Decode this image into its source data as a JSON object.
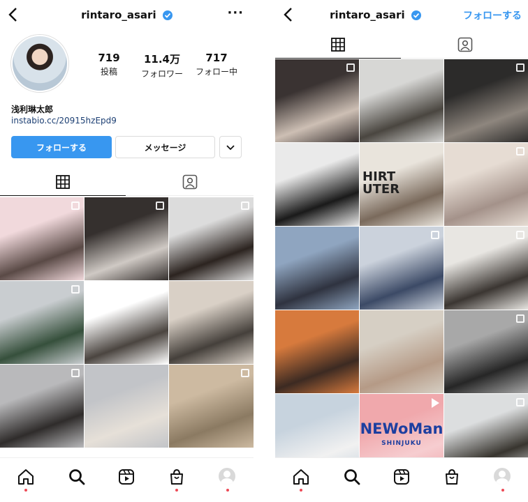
{
  "left": {
    "username": "rintaro_asari",
    "stats": [
      {
        "number": "719",
        "label": "投稿"
      },
      {
        "number": "11.4万",
        "label": "フォロワー"
      },
      {
        "number": "717",
        "label": "フォロー中"
      }
    ],
    "full_name": "浅利琳太郎",
    "bio_link": "instabio.cc/20915hzEpd9",
    "follow_button": "フォローする",
    "message_button": "メッセージ",
    "posts": [
      {
        "c1": "#f1d9dc",
        "c2": "#5a4a46",
        "badge": "multi"
      },
      {
        "c1": "#35302e",
        "c2": "#cfc9c4",
        "badge": "multi"
      },
      {
        "c1": "#dcdcdc",
        "c2": "#2c2420",
        "badge": "multi"
      },
      {
        "c1": "#c9cdd0",
        "c2": "#36503c",
        "badge": "multi"
      },
      {
        "c1": "#ffffff",
        "c2": "#4b4540",
        "badge": "multi"
      },
      {
        "c1": "#d9d0c6",
        "c2": "#45403b",
        "badge": "none"
      },
      {
        "c1": "#b9b9bb",
        "c2": "#2f2c2b",
        "badge": "multi"
      },
      {
        "c1": "#c2c4c8",
        "c2": "#e6e0d8",
        "badge": "none"
      },
      {
        "c1": "#cdbaa1",
        "c2": "#8b7a62",
        "badge": "multi"
      }
    ]
  },
  "right": {
    "username": "rintaro_asari",
    "follow_link": "フォローする",
    "posts": [
      {
        "c1": "#3a3332",
        "c2": "#cdbfb4",
        "badge": "multi"
      },
      {
        "c1": "#d7d7d5",
        "c2": "#4a4640",
        "badge": "none"
      },
      {
        "c1": "#2c2b2a",
        "c2": "#8e867e",
        "badge": "multi"
      },
      {
        "c1": "#eaeaea",
        "c2": "#1a1a1a",
        "badge": "none"
      },
      {
        "c1": "#e9e4dc",
        "c2": "#7a6a5c",
        "badge": "none",
        "text": "HIRT\nUTER"
      },
      {
        "c1": "#e6dcd3",
        "c2": "#a4928a",
        "badge": "multi"
      },
      {
        "c1": "#8fa5c0",
        "c2": "#2f3340",
        "badge": "none"
      },
      {
        "c1": "#cbd2dc",
        "c2": "#3c4a66",
        "badge": "multi"
      },
      {
        "c1": "#e8e6e2",
        "c2": "#3b3632",
        "badge": "multi"
      },
      {
        "c1": "#d77a3d",
        "c2": "#3c2a22",
        "badge": "none"
      },
      {
        "c1": "#d6cfc4",
        "c2": "#b59a86",
        "badge": "none"
      },
      {
        "c1": "#a8a8a8",
        "c2": "#262626",
        "badge": "multi"
      },
      {
        "c1": "#c7d3de",
        "c2": "#f1f1f1",
        "badge": "none"
      },
      {
        "c1": "#f0a8ac",
        "c2": "#f6cdd0",
        "badge": "play",
        "text": "NEWoMan",
        "sub": "SHINJUKU"
      },
      {
        "c1": "#dcdedf",
        "c2": "#38352f",
        "badge": "multi"
      }
    ]
  },
  "nav": [
    {
      "name": "home"
    },
    {
      "name": "search"
    },
    {
      "name": "reels"
    },
    {
      "name": "shop"
    },
    {
      "name": "profile"
    }
  ],
  "colors": {
    "accent": "#3897f0",
    "link": "#1c3f73",
    "notification": "#ed4956"
  }
}
